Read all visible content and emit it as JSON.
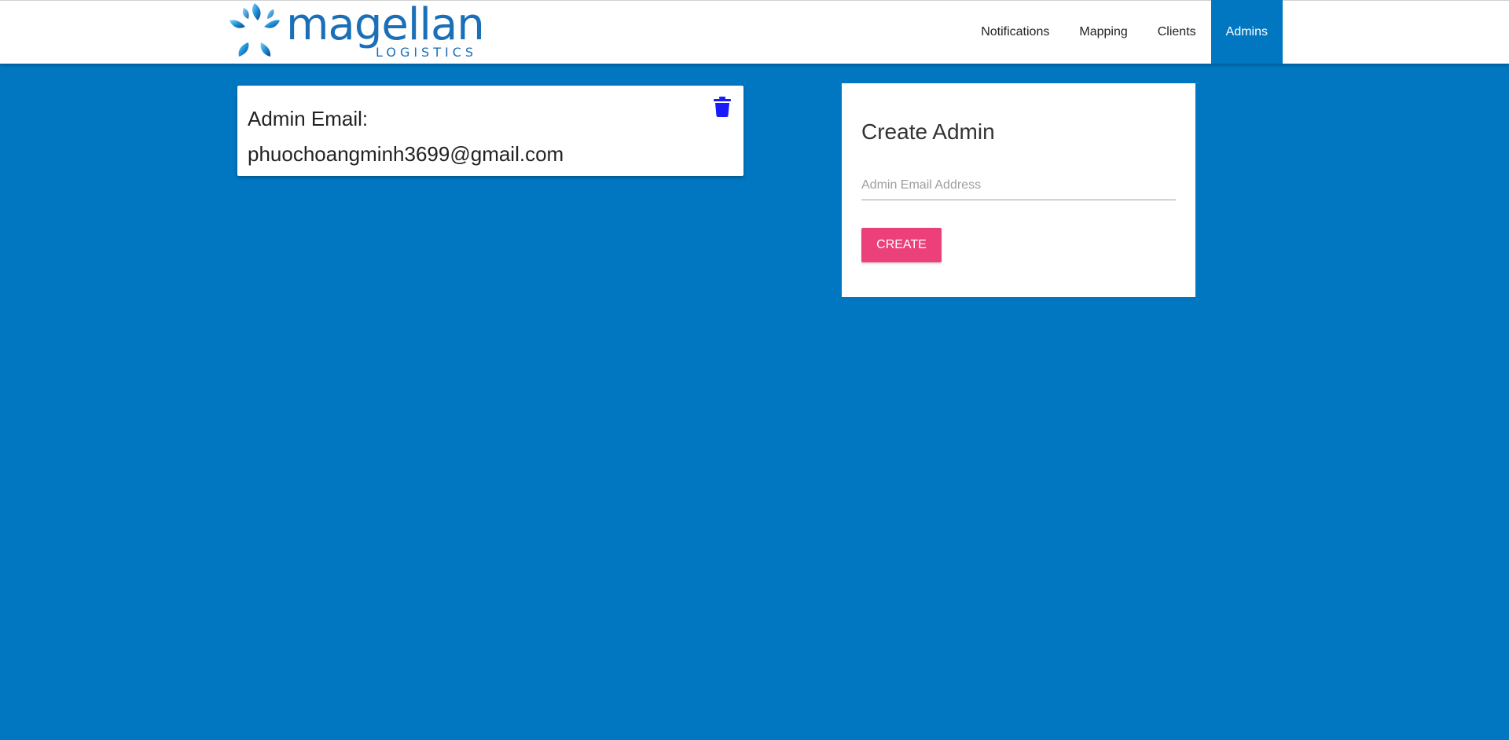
{
  "brand": {
    "name": "magellan",
    "subtitle": "LOGISTICS"
  },
  "nav": {
    "items": [
      {
        "label": "Notifications",
        "active": false
      },
      {
        "label": "Mapping",
        "active": false
      },
      {
        "label": "Clients",
        "active": false
      },
      {
        "label": "Admins",
        "active": true
      }
    ]
  },
  "admin_card": {
    "label": "Admin Email:",
    "email": "phuochoangminh3699@gmail.com",
    "delete_icon": "trash-icon"
  },
  "create_admin": {
    "title": "Create Admin",
    "email_value": "",
    "email_placeholder": "Admin Email Address",
    "button_label": "CREATE"
  },
  "colors": {
    "primary_blue": "#0077c0",
    "accent_pink": "#ec407a",
    "delete_icon": "#1a1aff"
  }
}
